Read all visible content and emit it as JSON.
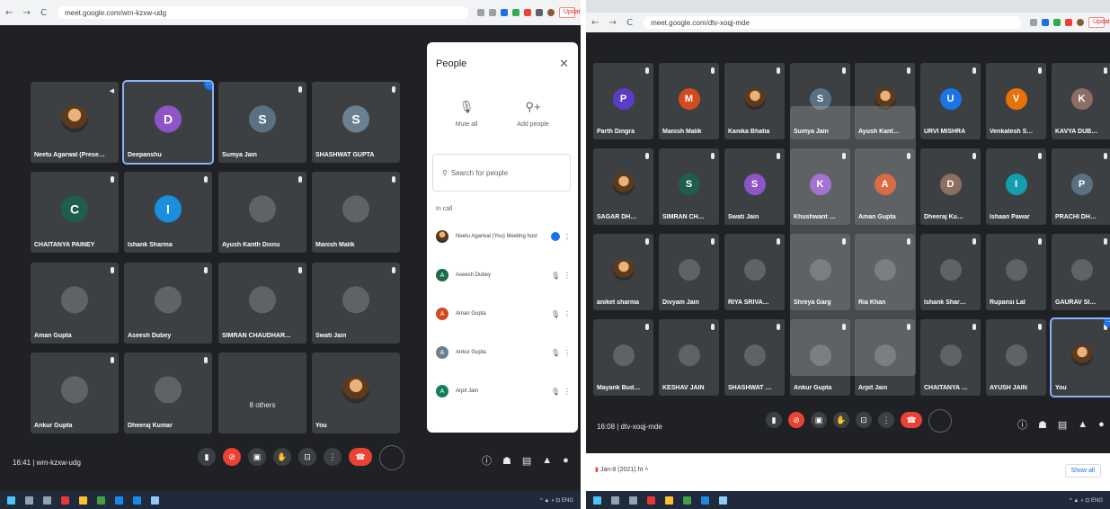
{
  "left": {
    "browser": {
      "nav_glyphs": "← → C",
      "url": "meet.google.com/wrn-kzxw-udg",
      "update_label": "Update"
    },
    "tiles": [
      {
        "name": "Neetu Agarwal (Presentat...",
        "initial": "",
        "color": "#3c4043",
        "photo": true,
        "status": "volume"
      },
      {
        "name": "Deepanshu",
        "initial": "D",
        "color": "#8e55c7",
        "selected": true,
        "status": "pin"
      },
      {
        "name": "Sumya Jain",
        "initial": "S",
        "color": "#5b7083",
        "status": "mic"
      },
      {
        "name": "SHASHWAT GUPTA",
        "initial": "S",
        "color": "#6b8090",
        "status": "mic"
      },
      {
        "name": "CHAITANYA PAINEY",
        "initial": "C",
        "color": "#1e5e4a",
        "status": "mic"
      },
      {
        "name": "Ishank Sharma",
        "initial": "I",
        "color": "#1a8fe0",
        "status": "mic"
      },
      {
        "name": "Ayush Kanth Dixnu",
        "initial": "",
        "color": "#5f6368",
        "status": "mic"
      },
      {
        "name": "Manish Malik",
        "initial": "",
        "color": "#5f6368",
        "status": "mic"
      },
      {
        "name": "Aman Gupta",
        "initial": "",
        "color": "#5f6368",
        "status": "mic"
      },
      {
        "name": "Aseesh Dubey",
        "initial": "",
        "color": "#5f6368",
        "status": "mic"
      },
      {
        "name": "SIMRAN CHAUDHARY BE...",
        "initial": "",
        "color": "#5f6368",
        "status": "mic"
      },
      {
        "name": "Swati Jain",
        "initial": "",
        "color": "#5f6368",
        "status": "mic"
      },
      {
        "name": "Ankur Gupta",
        "initial": "",
        "color": "#5f6368",
        "status": "mic"
      },
      {
        "name": "Dheeraj Kumar",
        "initial": "",
        "color": "#5f6368",
        "status": "mic"
      },
      {
        "name": "",
        "initial": "",
        "color": "#3c4043",
        "center_label": "8 others",
        "status": "none"
      },
      {
        "name": "You",
        "initial": "",
        "color": "#3c4043",
        "photo": true,
        "status": "none"
      }
    ],
    "meeting_code": "16:41 | wrn-kzxw-udg",
    "people": {
      "title": "People",
      "close": "✕",
      "mute_all": "Mute all",
      "add_people": "Add people",
      "search_placeholder": "Search for people",
      "in_call": "In call",
      "rows": [
        {
          "name": "Neetu Agarwal (You) Meeting host",
          "initial": "",
          "color": "#8a5a34",
          "photo": true
        },
        {
          "name": "Aseesh Dubey",
          "initial": "A",
          "color": "#1e6b4a"
        },
        {
          "name": "Aman Gupta",
          "initial": "A",
          "color": "#d14b1f"
        },
        {
          "name": "Ankur Gupta",
          "initial": "A",
          "color": "#6b8090"
        },
        {
          "name": "Arpit Jain",
          "initial": "A",
          "color": "#12805c"
        }
      ]
    }
  },
  "right": {
    "browser": {
      "nav_glyphs": "← → C",
      "url": "meet.google.com/dtv-xoqj-mde",
      "update_label": "Update"
    },
    "tiles": [
      {
        "name": "Parth Dingra",
        "initial": "P",
        "color": "#5b3cc4"
      },
      {
        "name": "Manish Malik",
        "initial": "M",
        "color": "#d14b1f"
      },
      {
        "name": "Kanika Bhatia",
        "initial": "",
        "color": "#3c4043",
        "photo": true
      },
      {
        "name": "Sumya Jain",
        "initial": "S",
        "color": "#5b7083"
      },
      {
        "name": "Ayush Kanth Dixnu",
        "initial": "",
        "color": "#3c4043",
        "photo": true
      },
      {
        "name": "URVI MISHRA",
        "initial": "U",
        "color": "#1a73e8"
      },
      {
        "name": "Venkatesh Saran",
        "initial": "V",
        "color": "#e8710a"
      },
      {
        "name": "KAVYA DUBEY",
        "initial": "K",
        "color": "#8d6e63"
      },
      {
        "name": "SAGAR DHAWAN",
        "initial": "",
        "color": "#3c4043",
        "photo": true
      },
      {
        "name": "SIMRAN CHAUDH...",
        "initial": "S",
        "color": "#1e5e4a"
      },
      {
        "name": "Swati Jain",
        "initial": "S",
        "color": "#8e55c7"
      },
      {
        "name": "Khushwant Malik",
        "initial": "K",
        "color": "#8e55c7"
      },
      {
        "name": "Aman Gupta",
        "initial": "A",
        "color": "#d14b1f"
      },
      {
        "name": "Dheeraj Kumar",
        "initial": "D",
        "color": "#8d6e63"
      },
      {
        "name": "Ishaan Pawar",
        "initial": "I",
        "color": "#129eaf"
      },
      {
        "name": "PRACHI DHAWAN",
        "initial": "P",
        "color": "#5b7083"
      },
      {
        "name": "aniket sharma",
        "initial": "",
        "color": "#3c4043",
        "photo": true
      },
      {
        "name": "Divyam Jain",
        "initial": "",
        "color": "#5f6368"
      },
      {
        "name": "RIYA SRIVASTAVA",
        "initial": "",
        "color": "#5f6368"
      },
      {
        "name": "Shreya Garg",
        "initial": "",
        "color": "#5f6368"
      },
      {
        "name": "Ria Khan",
        "initial": "",
        "color": "#5f6368"
      },
      {
        "name": "Ishank Sharma",
        "initial": "",
        "color": "#5f6368"
      },
      {
        "name": "Rupansi Lal",
        "initial": "",
        "color": "#5f6368"
      },
      {
        "name": "GAURAV SINGH",
        "initial": "",
        "color": "#5f6368"
      },
      {
        "name": "Mayank Budhiraja",
        "initial": "",
        "color": "#5f6368"
      },
      {
        "name": "KESHAV JAIN",
        "initial": "",
        "color": "#5f6368"
      },
      {
        "name": "SHASHWAT GUPTA",
        "initial": "",
        "color": "#5f6368"
      },
      {
        "name": "Ankur Gupta",
        "initial": "",
        "color": "#5f6368"
      },
      {
        "name": "Arpit Jain",
        "initial": "",
        "color": "#5f6368"
      },
      {
        "name": "CHAITANYA PATEL",
        "initial": "",
        "color": "#5f6368"
      },
      {
        "name": "AYUSH JAIN",
        "initial": "",
        "color": "#5f6368"
      },
      {
        "name": "You",
        "initial": "",
        "color": "#3c4043",
        "photo": true,
        "selected": true
      }
    ],
    "meeting_code": "16:08 | dtv-xoqj-mde",
    "download_file": "Jan-8 (2021).ht",
    "show_all": "Show all"
  }
}
